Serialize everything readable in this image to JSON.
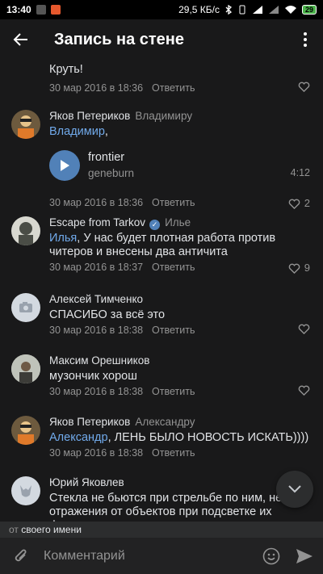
{
  "status_bar": {
    "time": "13:40",
    "network_speed": "29,5 КБ/с",
    "battery": "29"
  },
  "header": {
    "title": "Запись на стене",
    "back_icon": "arrow-left-icon",
    "more_icon": "more-vertical-icon"
  },
  "comments": [
    {
      "text": "Круть!",
      "date": "30 мар 2016 в 18:36",
      "reply_label": "Ответить",
      "likes": ""
    },
    {
      "author": "Яков Петериков",
      "reply_to": "Владимиру",
      "mention": "Владимир",
      "text": ",",
      "audio": {
        "title": "frontier",
        "artist": "geneburn",
        "duration": "4:12"
      },
      "date": "30 мар 2016 в 18:36",
      "reply_label": "Ответить",
      "likes": "2"
    },
    {
      "author": "Escape from Tarkov",
      "verified": true,
      "reply_to": "Илье",
      "mention": "Илья",
      "text": ", У нас будет плотная работа против читеров и внесены два античита",
      "date": "30 мар 2016 в 18:37",
      "reply_label": "Ответить",
      "likes": "9"
    },
    {
      "author": "Алексей Тимченко",
      "text": "СПАСИБО за всё это",
      "date": "30 мар 2016 в 18:38",
      "reply_label": "Ответить",
      "likes": ""
    },
    {
      "author": "Максим Орешников",
      "text": "музончик хорош",
      "date": "30 мар 2016 в 18:38",
      "reply_label": "Ответить",
      "likes": ""
    },
    {
      "author": "Яков Петериков",
      "reply_to": "Александру",
      "mention": "Александр",
      "text": ", ЛЕНЬ БЫЛО НОВОСТЬ ИСКАТЬ))))",
      "date": "30 мар 2016 в 18:38",
      "reply_label": "Ответить",
      "likes": ""
    },
    {
      "author": "Юрий Яковлев",
      "text": "Стекла не бьются при стрельбе по ним, нет отражения от объектов при подсветке их фонариком."
    }
  ],
  "composer": {
    "from_prefix": "от",
    "from_value": "своего имени",
    "placeholder": "Комментарий"
  },
  "colors": {
    "background": "#19191a",
    "accent": "#5181b8",
    "mention": "#71aaeb",
    "secondary_text": "#939393"
  }
}
